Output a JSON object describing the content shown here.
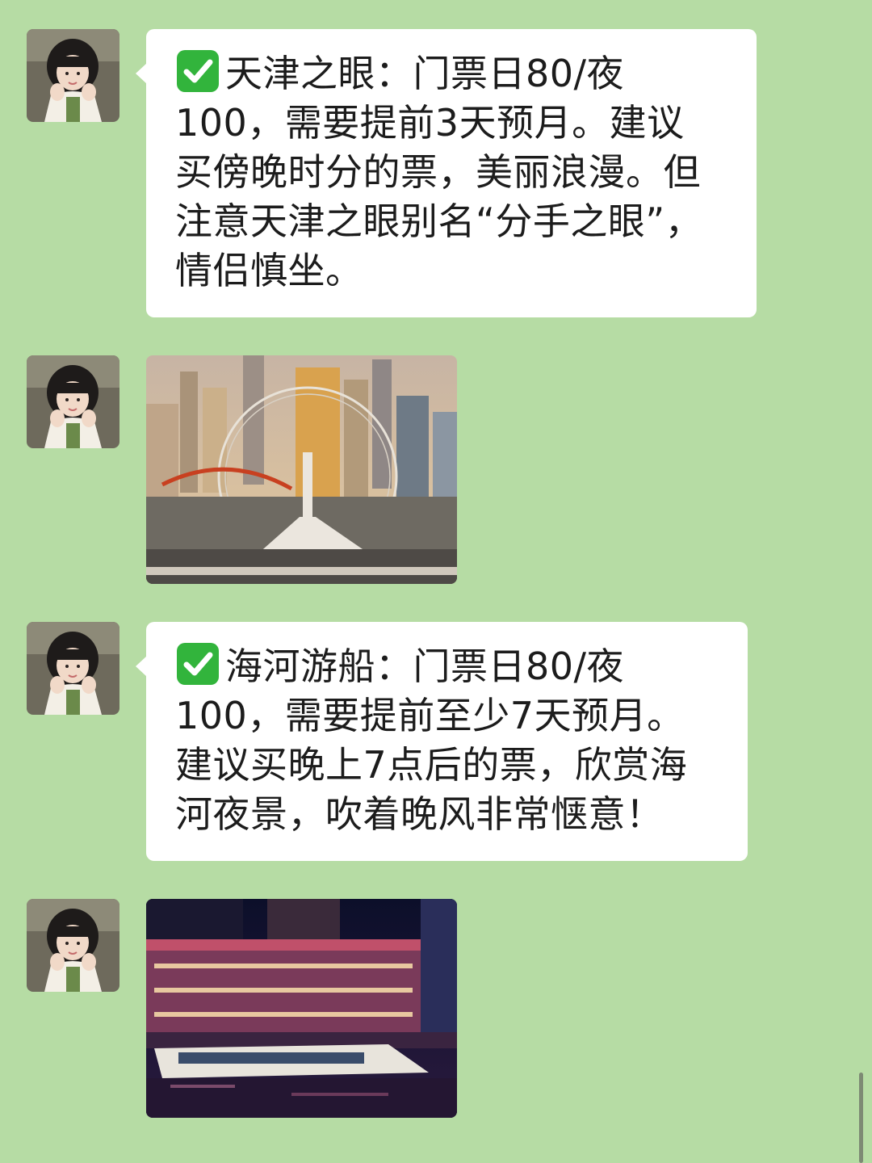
{
  "chat": {
    "background_color": "#b6dca4",
    "bubble_color": "#ffffff",
    "messages": [
      {
        "type": "text",
        "icon": "white-check-mark-emoji",
        "lines": [
          "天津之眼：门票日80/夜",
          "100，需要提前3天预月。建议",
          "买傍晚时分的票，美丽浪漫。但",
          "注意天津之眼别名“分手之眼”，",
          "情侣慎坐。"
        ]
      },
      {
        "type": "image",
        "image": "tianjin-eye-ferris-wheel-photo"
      },
      {
        "type": "text",
        "icon": "white-check-mark-emoji",
        "lines": [
          "海河游船：门票日80/夜",
          "100，需要提前至少7天预月。",
          "建议买晚上7点后的票，欣赏海",
          "河夜景，吹着晚风非常惬意！"
        ]
      },
      {
        "type": "image",
        "image": "haihe-river-cruise-night-photo"
      }
    ]
  }
}
